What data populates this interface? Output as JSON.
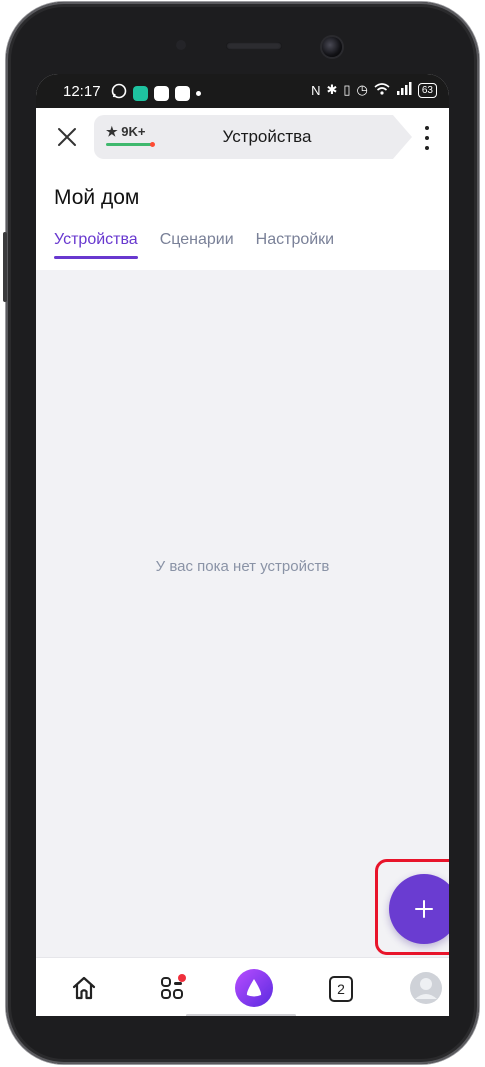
{
  "status_bar": {
    "time": "12:17",
    "battery": "63"
  },
  "toolbar": {
    "rating": "★ 9K+",
    "title": "Устройства"
  },
  "page": {
    "title": "Мой дом",
    "tabs": [
      {
        "label": "Устройства",
        "active": true
      },
      {
        "label": "Сценарии",
        "active": false
      },
      {
        "label": "Настройки",
        "active": false
      }
    ],
    "empty_message": "У вас пока нет устройств"
  },
  "fab": {
    "icon": "plus-icon"
  },
  "bottom_nav": {
    "items": [
      {
        "icon": "home-icon"
      },
      {
        "icon": "services-icon",
        "has_notification": true
      },
      {
        "icon": "alice-icon"
      },
      {
        "icon": "tabs-icon",
        "label": "2"
      },
      {
        "icon": "profile-avatar"
      }
    ]
  },
  "colors": {
    "accent": "#6838cf",
    "fab": "#6a3cd1",
    "highlight": "#e8142a"
  }
}
